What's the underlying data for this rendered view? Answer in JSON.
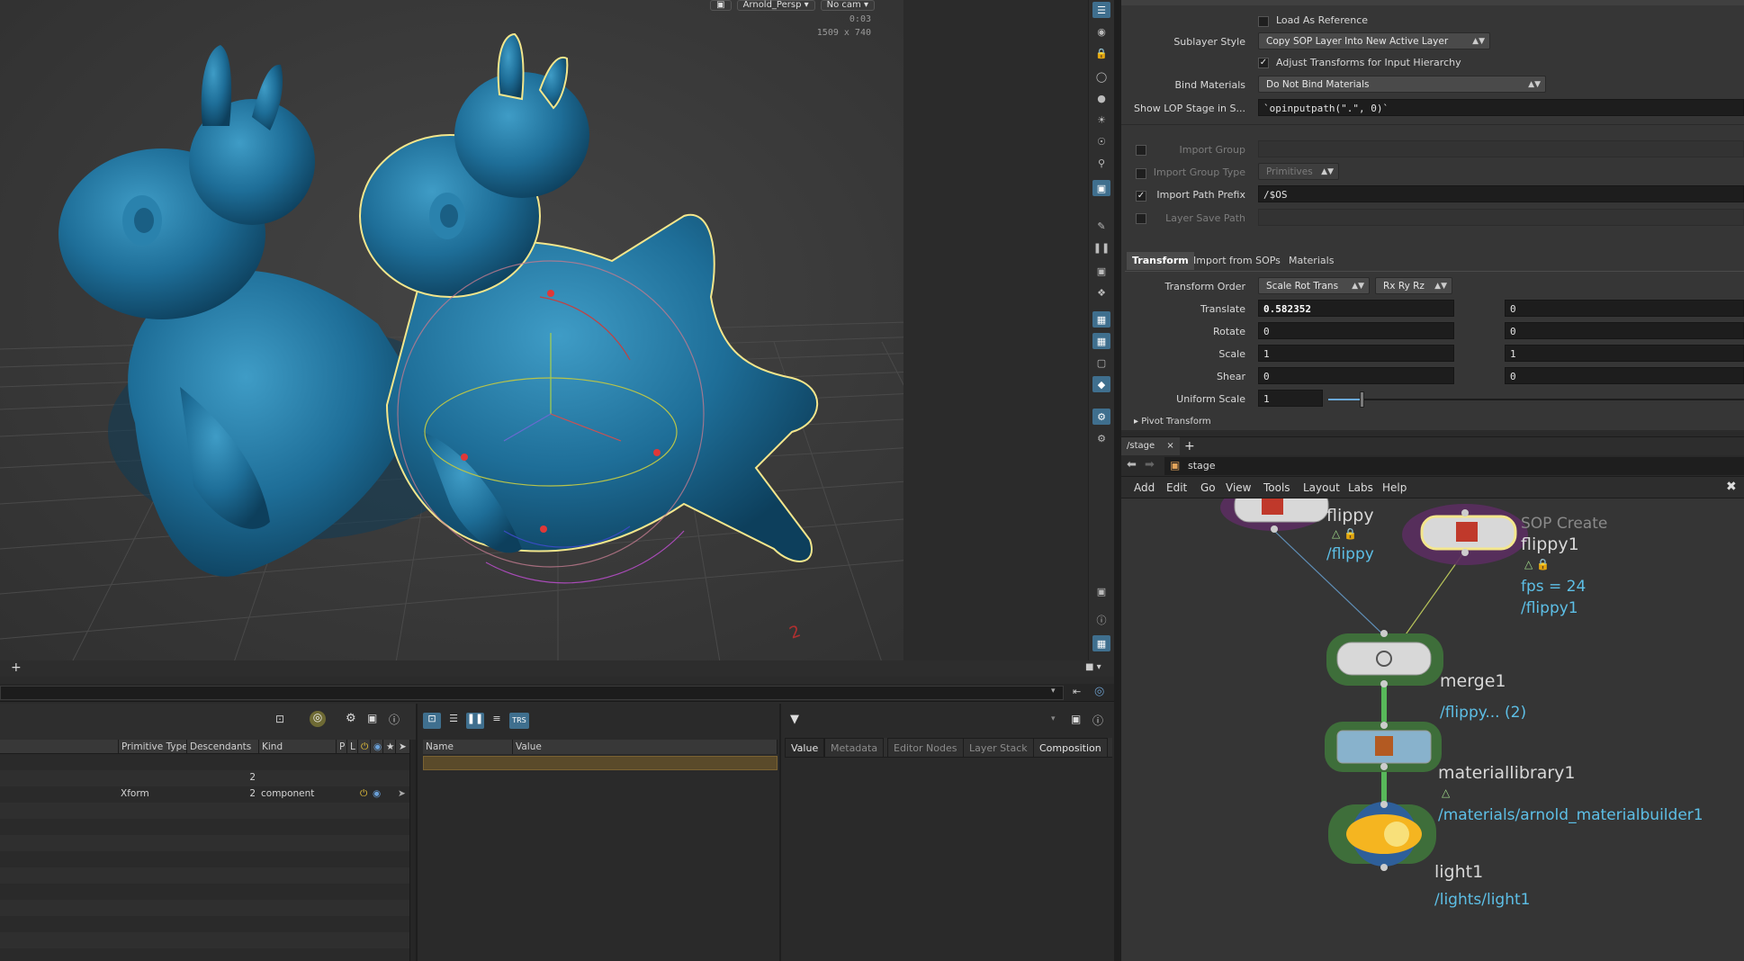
{
  "viewport": {
    "camera_menu": "Arnold_Persp",
    "cam_menu": "No cam",
    "time_stat": "0:03",
    "res_stat": "1509 x 740",
    "plus_label": "+"
  },
  "scene_browser": {
    "columns": [
      "Primitive Type",
      "Descendants",
      "Kind",
      "P",
      "L"
    ],
    "rows": [
      {
        "type": "",
        "descendants": "2",
        "kind": ""
      },
      {
        "type": "Xform",
        "descendants": "2",
        "kind": "component"
      }
    ]
  },
  "attr_panel": {
    "columns": [
      "Name",
      "Value"
    ],
    "tabs": [
      "Value",
      "Metadata",
      "Editor Nodes",
      "Layer Stack",
      "Composition"
    ]
  },
  "params": {
    "load_as_reference": "Load As Reference",
    "sublayer_style_label": "Sublayer Style",
    "sublayer_style_value": "Copy SOP Layer Into New Active Layer",
    "adjust_transforms": "Adjust Transforms for Input Hierarchy",
    "bind_materials_label": "Bind Materials",
    "bind_materials_value": "Do Not Bind Materials",
    "show_lop_label": "Show LOP Stage in S...",
    "show_lop_value": "`opinputpath(\".\", 0)`",
    "import_group_label": "Import Group",
    "import_group_type_label": "Import Group Type",
    "import_group_type_value": "Primitives",
    "import_path_prefix_label": "Import Path Prefix",
    "import_path_prefix_value": "/$OS",
    "layer_save_path_label": "Layer Save Path",
    "tabs": [
      "Transform",
      "Import from SOPs",
      "Materials"
    ],
    "transform_order_label": "Transform Order",
    "transform_order_value": "Scale Rot Trans",
    "rot_order_value": "Rx Ry Rz",
    "translate_label": "Translate",
    "translate_x": "0.582352",
    "translate_y": "0",
    "rotate_label": "Rotate",
    "rotate_x": "0",
    "rotate_y": "0",
    "scale_label": "Scale",
    "scale_x": "1",
    "scale_y": "1",
    "shear_label": "Shear",
    "shear_x": "0",
    "shear_y": "0",
    "uniform_scale_label": "Uniform Scale",
    "uniform_scale_value": "1",
    "uniform_scale_fraction": 0.08,
    "pivot_label": "Pivot Transform"
  },
  "network": {
    "tab_label": "/stage",
    "close_label": "×",
    "add_tab_label": "+",
    "path_label": "stage",
    "menu": [
      "Add",
      "Edit",
      "Go",
      "View",
      "Tools",
      "Layout",
      "Labs",
      "Help"
    ],
    "nodes": {
      "flippy": {
        "name": "flippy",
        "path": "/flippy"
      },
      "flippy1": {
        "type_label": "SOP Create",
        "name": "flippy1",
        "fps": "fps = 24",
        "path": "/flippy1"
      },
      "merge1": {
        "name": "merge1",
        "path": "/flippy... (2)"
      },
      "materiallibrary1": {
        "name": "materiallibrary1",
        "path": "/materials/arnold_materialbuilder1"
      },
      "light1": {
        "name": "light1",
        "path": "/lights/light1"
      }
    }
  },
  "colors": {
    "model_blue": "#1e6e98",
    "path_blue": "#5dbfe6",
    "selection_yellow": "#f3e68c"
  }
}
